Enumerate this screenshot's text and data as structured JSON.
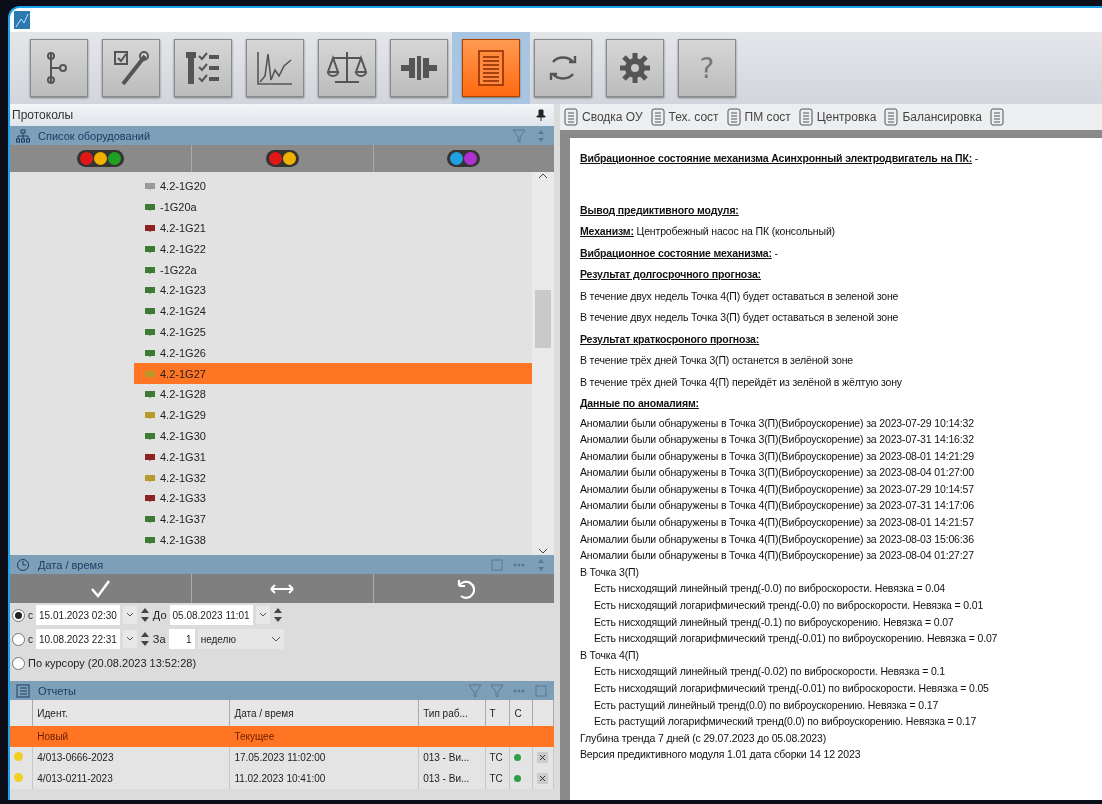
{
  "toolbar": [
    {
      "kind": "tree",
      "selected": false
    },
    {
      "kind": "check-wrench",
      "selected": false
    },
    {
      "kind": "checklist",
      "selected": false
    },
    {
      "kind": "chart",
      "selected": false
    },
    {
      "kind": "scales",
      "selected": false
    },
    {
      "kind": "coupling",
      "selected": false
    },
    {
      "kind": "report",
      "selected": true
    },
    {
      "kind": "sync",
      "selected": false
    },
    {
      "kind": "gear",
      "selected": false
    },
    {
      "kind": "text",
      "label": "?",
      "selected": false
    }
  ],
  "protocols": {
    "title": "Протоколы"
  },
  "equipment": {
    "title": "Список оборудований",
    "lights": [
      {
        "dots": [
          {
            "color": "#e01818"
          },
          {
            "color": "#f0b000"
          },
          {
            "color": "#20a020"
          }
        ]
      },
      {
        "dots": [
          {
            "color": "#e01818"
          },
          {
            "color": "#f0b000"
          }
        ]
      },
      {
        "dots": [
          {
            "color": "#20a0e0"
          },
          {
            "color": "#b030d0"
          }
        ]
      }
    ],
    "items": [
      {
        "label": "4.2-1G20",
        "color": "#9a9a9a",
        "selected": false
      },
      {
        "label": "-1G20a",
        "color": "#3d7a34",
        "selected": false
      },
      {
        "label": "4.2-1G21",
        "color": "#8e2222",
        "selected": false
      },
      {
        "label": "4.2-1G22",
        "color": "#3d7a34",
        "selected": false
      },
      {
        "label": "-1G22a",
        "color": "#3d7a34",
        "selected": false
      },
      {
        "label": "4.2-1G23",
        "color": "#3d7a34",
        "selected": false
      },
      {
        "label": "4.2-1G24",
        "color": "#3d7a34",
        "selected": false
      },
      {
        "label": "4.2-1G25",
        "color": "#3d7a34",
        "selected": false
      },
      {
        "label": "4.2-1G26",
        "color": "#3d7a34",
        "selected": false
      },
      {
        "label": "4.2-1G27",
        "color": "#b89a2c",
        "selected": true
      },
      {
        "label": "4.2-1G28",
        "color": "#3d7a34",
        "selected": false
      },
      {
        "label": "4.2-1G29",
        "color": "#b89a2c",
        "selected": false
      },
      {
        "label": "4.2-1G30",
        "color": "#3d7a34",
        "selected": false
      },
      {
        "label": "4.2-1G31",
        "color": "#8e2222",
        "selected": false
      },
      {
        "label": "4.2-1G32",
        "color": "#b89a2c",
        "selected": false
      },
      {
        "label": "4.2-1G33",
        "color": "#8e2222",
        "selected": false
      },
      {
        "label": "4.2-1G37",
        "color": "#3d7a34",
        "selected": false
      },
      {
        "label": "4.2-1G38",
        "color": "#3d7a34",
        "selected": false
      }
    ]
  },
  "datetime": {
    "title": "Дата / время",
    "options": [
      {
        "kind": "range",
        "selected": true,
        "prefix": "с",
        "from": "15.01.2023 02:30",
        "to_label": "До",
        "to": "05.08.2023 11:01"
      },
      {
        "kind": "period",
        "selected": false,
        "prefix": "с",
        "from": "10.08.2023 22:31",
        "for_label": "За",
        "count": "1",
        "unit": "неделю"
      },
      {
        "kind": "cursor",
        "selected": false,
        "label": "По курсору (20.08.2023 13:52:28)"
      }
    ]
  },
  "reports": {
    "title": "Отчеты",
    "columns": [
      "Идент.",
      "Дата / время",
      "Тип раб...",
      "Т",
      "С"
    ],
    "rows": [
      {
        "selected": true,
        "marker": false,
        "id": "Новый",
        "date": "Текущее"
      },
      {
        "selected": false,
        "marker": true,
        "id": "4/013-0666-2023",
        "date": "17.05.2023 11:02:00",
        "type": "013 - Ви...",
        "t": "ТС",
        "color": "#2ea043"
      },
      {
        "selected": false,
        "marker": true,
        "id": "4/013-0211-2023",
        "date": "11.02.2023 10:41:00",
        "type": "013 - Ви...",
        "t": "ТС",
        "color": "#2ea043"
      }
    ]
  },
  "doc_tabs": [
    {
      "kind": "labeled",
      "label": "Сводка ОУ"
    },
    {
      "kind": "labeled",
      "label": "Тех. сост"
    },
    {
      "kind": "labeled",
      "label": "ПМ сост"
    },
    {
      "kind": "labeled",
      "label": "Центровка"
    },
    {
      "kind": "labeled",
      "label": "Балансировка"
    },
    {
      "kind": "icon"
    }
  ],
  "document": [
    {
      "kind": "heading",
      "text": "Вибрационное состояние механизма Асинхронный электродвигатель на ПК:",
      "rest": " -"
    },
    {
      "kind": "gap"
    },
    {
      "kind": "heading",
      "text": "Вывод предиктивного модуля:"
    },
    {
      "kind": "heading",
      "text": "Механизм:",
      "rest": " Центробежный насос на ПК (консольный)"
    },
    {
      "kind": "heading",
      "text": "Вибрационное состояние механизма:",
      "rest": " -"
    },
    {
      "kind": "heading",
      "text": "Результат долгосрочного прогноза:"
    },
    {
      "kind": "text",
      "text": "В течение двух недель Точка 4(П) будет оставаться в зеленой зоне"
    },
    {
      "kind": "text",
      "text": "В течение двух недель Точка 3(П) будет оставаться в зеленой зоне"
    },
    {
      "kind": "heading",
      "text": "Результат краткосроного прогноза:"
    },
    {
      "kind": "text",
      "text": "В течение трёх дней Точка 3(П) останется в зелёной зоне"
    },
    {
      "kind": "text",
      "text": "В течение трёх дней Точка 4(П) перейдёт из зелёной в жёлтую зону"
    },
    {
      "kind": "heading",
      "text": "Данные по аномалиям:"
    },
    {
      "kind": "line",
      "text": "Аномалии были обнаружены в Точка 3(П)(Виброускорение) за 2023-07-29 10:14:32"
    },
    {
      "kind": "line",
      "text": "Аномалии были обнаружены в Точка 3(П)(Виброускорение) за 2023-07-31 14:16:32"
    },
    {
      "kind": "line",
      "text": "Аномалии были обнаружены в Точка 3(П)(Виброускорение) за 2023-08-01 14:21:29"
    },
    {
      "kind": "line",
      "text": "Аномалии были обнаружены в Точка 3(П)(Виброускорение) за 2023-08-04 01:27:00"
    },
    {
      "kind": "line",
      "text": "Аномалии были обнаружены в Точка 4(П)(Виброускорение) за 2023-07-29 10:14:57"
    },
    {
      "kind": "line",
      "text": "Аномалии были обнаружены в Точка 4(П)(Виброускорение) за 2023-07-31 14:17:06"
    },
    {
      "kind": "line",
      "text": "Аномалии были обнаружены в Точка 4(П)(Виброускорение) за 2023-08-01 14:21:57"
    },
    {
      "kind": "line",
      "text": "Аномалии были обнаружены в Точка 4(П)(Виброускорение) за 2023-08-03 15:06:36"
    },
    {
      "kind": "line",
      "text": "Аномалии были обнаружены в Точка 4(П)(Виброускорение) за 2023-08-04 01:27:27"
    },
    {
      "kind": "line",
      "text": "В Точка 3(П)"
    },
    {
      "kind": "indent",
      "text": "Есть нисходящий линейный тренд(-0.0) по виброскорости. Невязка = 0.04"
    },
    {
      "kind": "indent",
      "text": "Есть нисходящий логарифмический тренд(-0.0) по виброскорости. Невязка = 0.01"
    },
    {
      "kind": "indent",
      "text": "Есть нисходящий линейный тренд(-0.1) по виброускорению. Невязка = 0.07"
    },
    {
      "kind": "indent",
      "text": "Есть нисходящий логарифмический тренд(-0.01) по виброускорению. Невязка = 0.07"
    },
    {
      "kind": "line",
      "text": "В Точка 4(П)"
    },
    {
      "kind": "indent",
      "text": "Есть нисходящий линейный тренд(-0.02) по виброскорости. Невязка = 0.1"
    },
    {
      "kind": "indent",
      "text": "Есть нисходящий логарифмический тренд(-0.01) по виброскорости. Невязка = 0.05"
    },
    {
      "kind": "indent",
      "text": "Есть растущий линейный тренд(0.0) по виброускорению. Невязка = 0.17"
    },
    {
      "kind": "indent",
      "text": "Есть растущий логарифмический тренд(0.0) по виброускорению. Невязка = 0.17"
    },
    {
      "kind": "line",
      "text": "Глубина тренда 7 дней (с 29.07.2023 до 05.08.2023)"
    },
    {
      "kind": "line",
      "text": "Версия предиктивного модуля 1.01 дата сборки 14 12 2023"
    }
  ]
}
